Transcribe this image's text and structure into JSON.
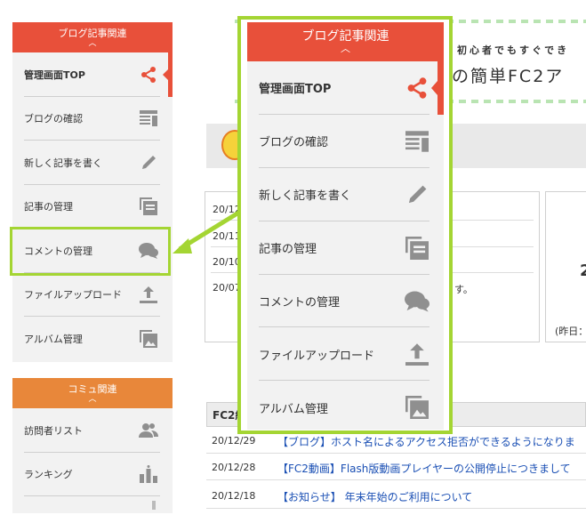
{
  "sidebar": {
    "blog_section_title": "ブログ記事関連",
    "blog_items": [
      {
        "label": "管理画面TOP",
        "icon": "share-icon"
      },
      {
        "label": "ブログの確認",
        "icon": "article-icon"
      },
      {
        "label": "新しく記事を書く",
        "icon": "pencil-icon"
      },
      {
        "label": "記事の管理",
        "icon": "copy-stack-icon"
      },
      {
        "label": "コメントの管理",
        "icon": "comment-bubbles-icon"
      },
      {
        "label": "ファイルアップロード",
        "icon": "upload-icon"
      },
      {
        "label": "アルバム管理",
        "icon": "gallery-icon"
      }
    ],
    "community_section_title": "コミュ関連",
    "community_items": [
      {
        "label": "訪問者リスト",
        "icon": "users-icon"
      },
      {
        "label": "ランキング",
        "icon": "ranking-icon"
      }
    ]
  },
  "banner": {
    "small_text": "初心者でもすぐでき",
    "big_text": "の簡単FC2ア"
  },
  "info_box": {
    "dates": [
      "20/12",
      "20/11",
      "20/10",
      "20/07"
    ],
    "fragment": "す。"
  },
  "stats_box": {
    "value": "2",
    "yesterday_label": "(昨日："
  },
  "news": {
    "header": "FC2紀",
    "rows": [
      {
        "date": "20/12/29",
        "title": "【ブログ】ホスト名によるアクセス拒否ができるようになりま"
      },
      {
        "date": "20/12/28",
        "title": "【FC2動画】Flash版動画プレイヤーの公開停止につきまして"
      },
      {
        "date": "20/12/18",
        "title": "【お知らせ】 年末年始のご利用について"
      }
    ]
  },
  "colors": {
    "blog_header": "#e8503a",
    "community_header": "#e8873a",
    "highlight": "#a4d533",
    "link": "#1a4fb4"
  }
}
